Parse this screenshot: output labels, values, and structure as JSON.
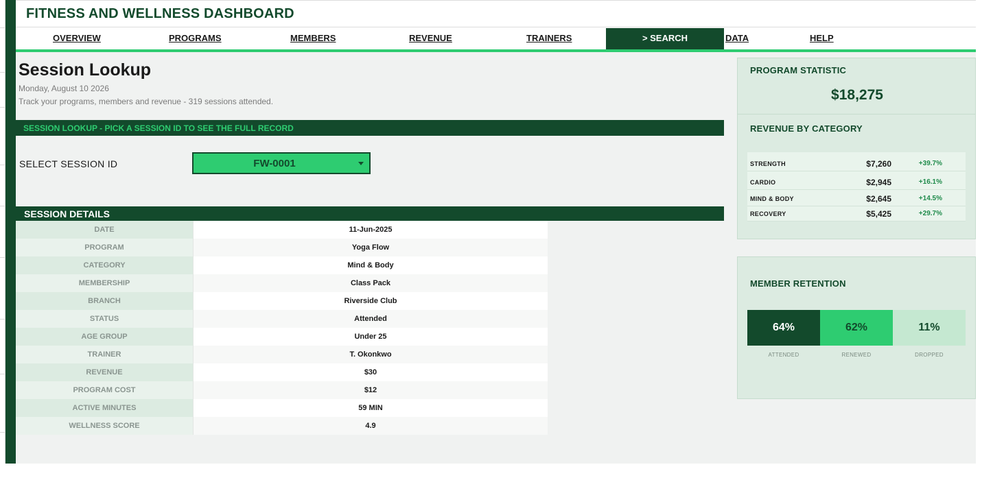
{
  "header": {
    "title": "FITNESS AND WELLNESS DASHBOARD"
  },
  "nav": {
    "items": [
      "OVERVIEW",
      "PROGRAMS",
      "MEMBERS",
      "REVENUE",
      "TRAINERS"
    ],
    "active": "> SEARCH",
    "items_after": [
      "DATA",
      "HELP"
    ]
  },
  "page": {
    "title": "Session Lookup",
    "date": "Monday, August 10 2026",
    "tagline": "Track your programs, members and revenue  -  319 sessions attended."
  },
  "lookup": {
    "band": "SESSION LOOKUP  -  PICK A SESSION ID TO SEE THE FULL RECORD",
    "select_label": "SELECT SESSION ID",
    "selected_id": "FW-0001"
  },
  "details": {
    "title": "SESSION DETAILS",
    "rows": [
      {
        "label": "DATE",
        "value": "11-Jun-2025"
      },
      {
        "label": "PROGRAM",
        "value": "Yoga Flow"
      },
      {
        "label": "CATEGORY",
        "value": "Mind & Body"
      },
      {
        "label": "MEMBERSHIP",
        "value": "Class Pack"
      },
      {
        "label": "BRANCH",
        "value": "Riverside Club"
      },
      {
        "label": "STATUS",
        "value": "Attended"
      },
      {
        "label": "AGE GROUP",
        "value": "Under 25"
      },
      {
        "label": "TRAINER",
        "value": "T. Okonkwo"
      },
      {
        "label": "REVENUE",
        "value": "$30"
      },
      {
        "label": "PROGRAM COST",
        "value": "$12"
      },
      {
        "label": "ACTIVE MINUTES",
        "value": "59 MIN"
      },
      {
        "label": "WELLNESS SCORE",
        "value": "4.9"
      }
    ]
  },
  "stats": {
    "title": "PROGRAM STATISTIC",
    "total": "$18,275",
    "revenue_title": "REVENUE BY CATEGORY",
    "categories": [
      {
        "name": "STRENGTH",
        "amount": "$7,260",
        "change": "+39.7%"
      },
      {
        "name": "CARDIO",
        "amount": "$2,945",
        "change": "+16.1%"
      },
      {
        "name": "MIND & BODY",
        "amount": "$2,645",
        "change": "+14.5%"
      },
      {
        "name": "RECOVERY",
        "amount": "$5,425",
        "change": "+29.7%"
      }
    ]
  },
  "retention": {
    "title": "MEMBER RETENTION",
    "items": [
      {
        "value": "64%",
        "label": "ATTENDED",
        "bg": "#134a2c",
        "fg": "#ffffff"
      },
      {
        "value": "62%",
        "label": "RENEWED",
        "bg": "#2ecc71",
        "fg": "#134a2c"
      },
      {
        "value": "11%",
        "label": "DROPPED",
        "bg": "#c5e8d1",
        "fg": "#134a2c"
      }
    ]
  },
  "colors": {
    "primary": "#134a2c",
    "accent": "#2ecc71",
    "panel": "#dcebe1",
    "background": "#f0f2f1"
  }
}
